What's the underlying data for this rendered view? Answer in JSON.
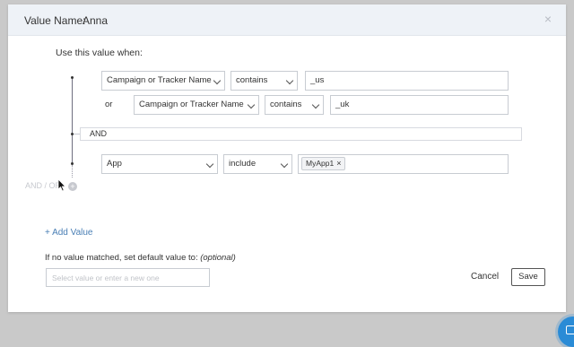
{
  "modal": {
    "title_label": "Value Name:",
    "title_value": "Anna",
    "close_glyph": "×"
  },
  "intro": "Use this value when:",
  "group1": {
    "row1": {
      "field": "Campaign or Tracker Name",
      "operator": "contains",
      "value": "_us"
    },
    "or_label": "or",
    "row2": {
      "field": "Campaign or Tracker Name",
      "operator": "contains",
      "value": "_uk"
    }
  },
  "and_label": "AND",
  "group2": {
    "row1": {
      "field": "App",
      "operator": "include",
      "tags": [
        "MyApp1"
      ]
    }
  },
  "andor": "AND / OR",
  "add_value": "+ Add Value",
  "default": {
    "label": "If no value matched, set default value to:",
    "optional": "(optional)",
    "placeholder": "Select value or enter a new one"
  },
  "buttons": {
    "cancel": "Cancel",
    "save": "Save"
  },
  "icons": {
    "close": "close-icon",
    "chevron": "chevron-down-icon",
    "tag_remove": "remove-tag-icon",
    "add_condition": "plus-circle-icon",
    "chat": "chat-icon"
  },
  "colors": {
    "header_bg": "#eef2f7",
    "link": "#4a7fb5",
    "chat": "#2a8bd6",
    "tree_line": "#6f6f80"
  }
}
